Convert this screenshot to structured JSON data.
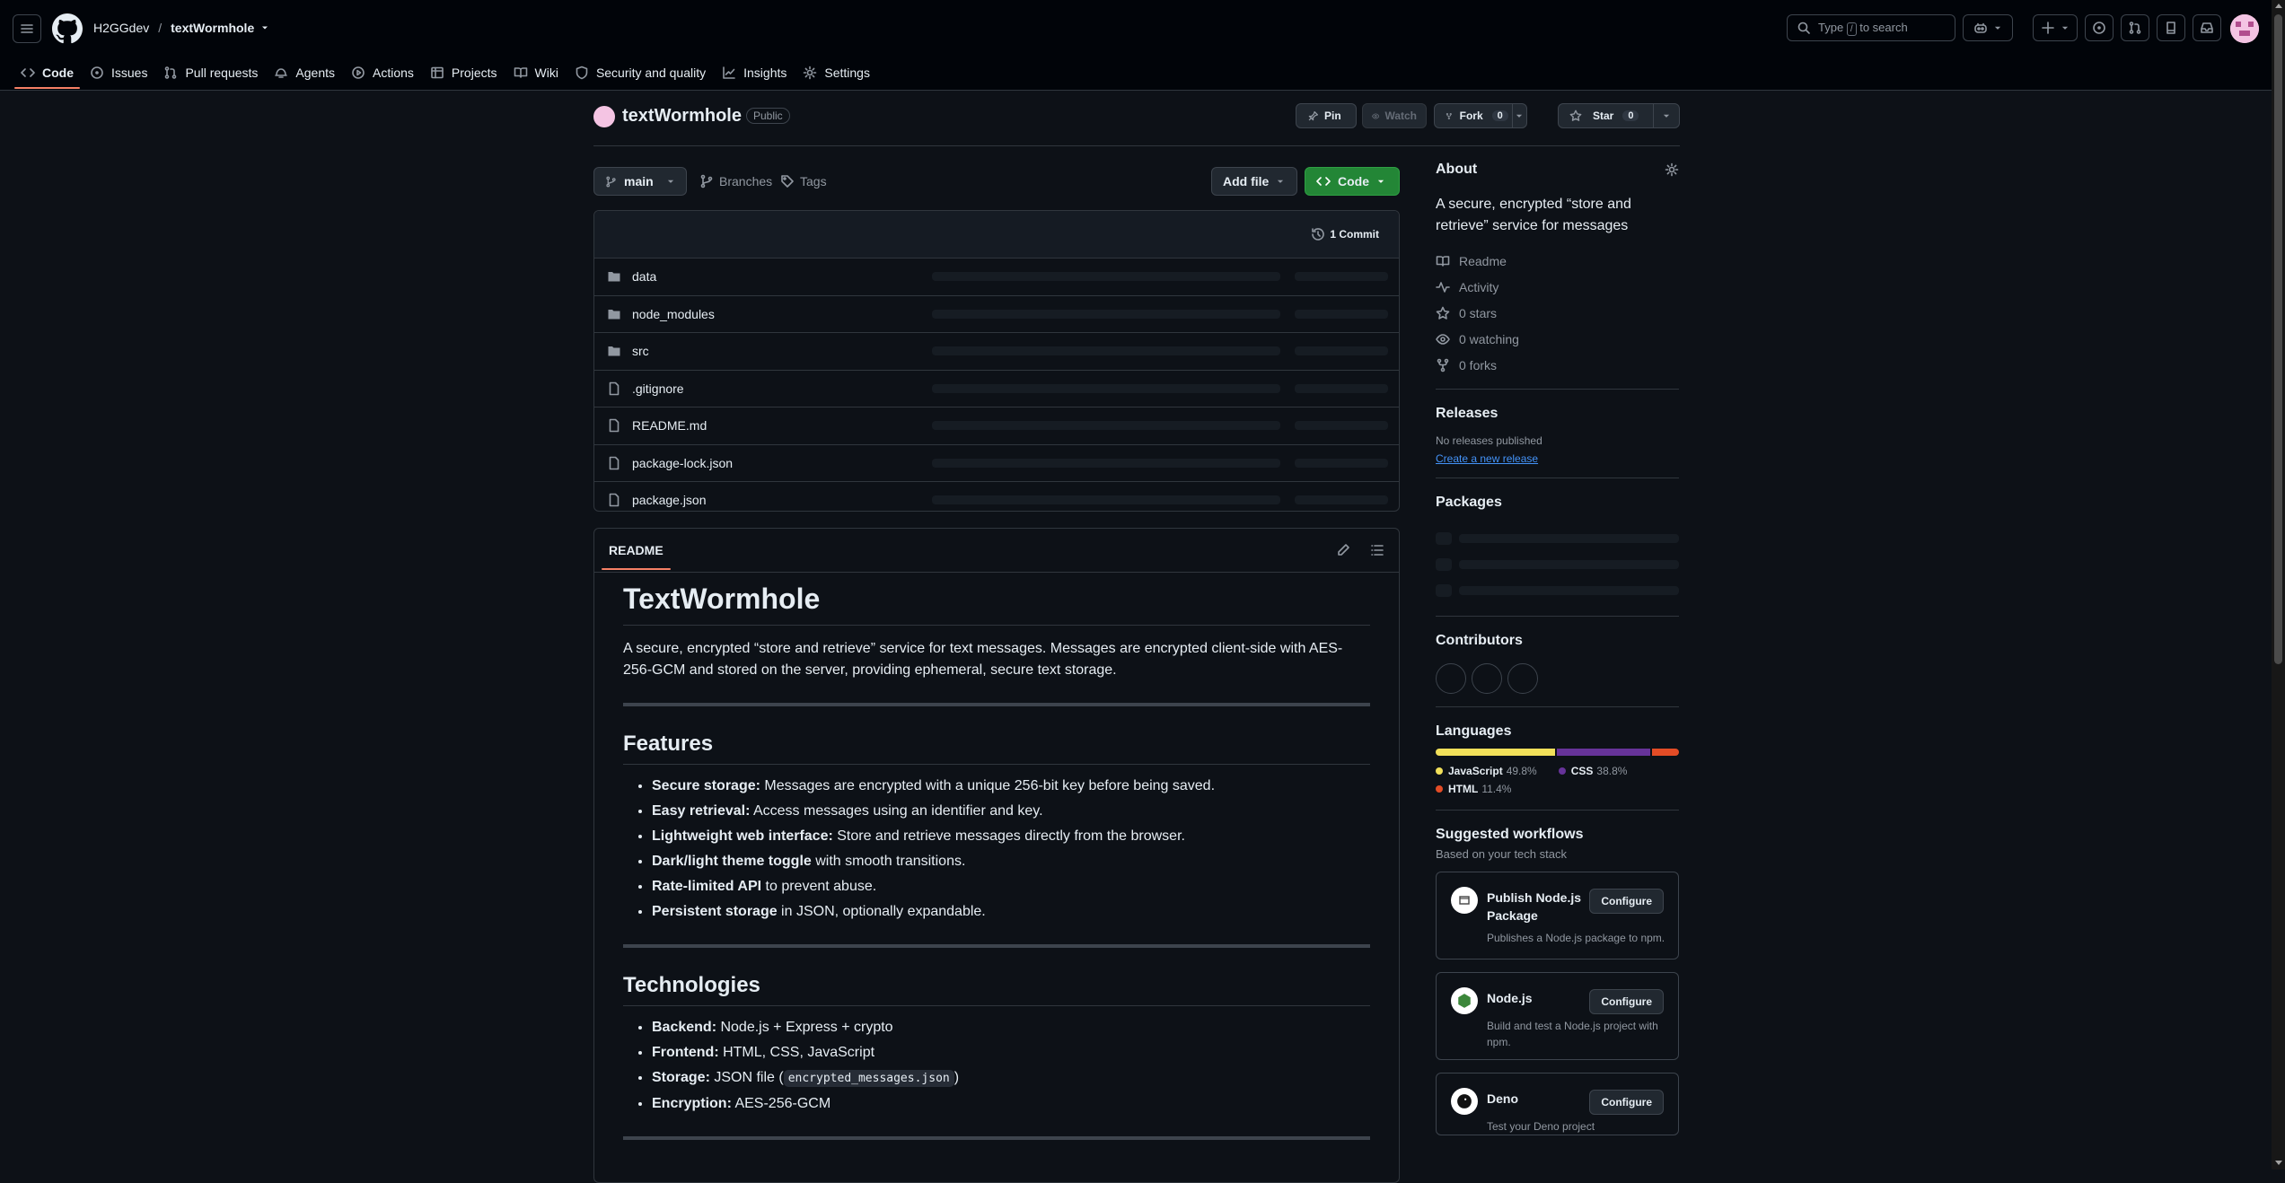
{
  "header": {
    "owner": "H2GGdev",
    "separator": "/",
    "repo": "textWormhole",
    "search_prefix": "Type",
    "search_key": "/",
    "search_suffix": "to search"
  },
  "tabs": [
    {
      "label": "Code",
      "icon": "code-icon"
    },
    {
      "label": "Issues",
      "icon": "issue-icon"
    },
    {
      "label": "Pull requests",
      "icon": "pull-request-icon"
    },
    {
      "label": "Agents",
      "icon": "agents-icon"
    },
    {
      "label": "Actions",
      "icon": "play-icon"
    },
    {
      "label": "Projects",
      "icon": "table-icon"
    },
    {
      "label": "Wiki",
      "icon": "book-icon"
    },
    {
      "label": "Security and quality",
      "icon": "shield-icon"
    },
    {
      "label": "Insights",
      "icon": "graph-icon"
    },
    {
      "label": "Settings",
      "icon": "gear-icon"
    }
  ],
  "repo_head": {
    "name": "textWormhole",
    "visibility": "Public",
    "pin": "Pin",
    "watch": "Watch",
    "fork": "Fork",
    "fork_count": "0",
    "star": "Star",
    "star_count": "0"
  },
  "file_nav": {
    "branch": "main",
    "branches": "Branches",
    "tags": "Tags",
    "add_file": "Add file",
    "code": "Code",
    "commits": "1 Commit"
  },
  "files": [
    {
      "name": "data",
      "type": "folder"
    },
    {
      "name": "node_modules",
      "type": "folder"
    },
    {
      "name": "src",
      "type": "folder"
    },
    {
      "name": ".gitignore",
      "type": "file"
    },
    {
      "name": "README.md",
      "type": "file"
    },
    {
      "name": "package-lock.json",
      "type": "file"
    },
    {
      "name": "package.json",
      "type": "file"
    }
  ],
  "readme": {
    "tab": "README",
    "title": "TextWormhole",
    "intro": "A secure, encrypted “store and retrieve” service for text messages. Messages are encrypted client-side with AES-256-GCM and stored on the server, providing ephemeral, secure text storage.",
    "features_heading": "Features",
    "features": [
      {
        "bold": "Secure storage:",
        "text": " Messages are encrypted with a unique 256-bit key before being saved."
      },
      {
        "bold": "Easy retrieval:",
        "text": " Access messages using an identifier and key."
      },
      {
        "bold": "Lightweight web interface:",
        "text": " Store and retrieve messages directly from the browser."
      },
      {
        "bold": "Dark/light theme toggle",
        "text": " with smooth transitions."
      },
      {
        "bold": "Rate-limited API",
        "text": " to prevent abuse."
      },
      {
        "bold": "Persistent storage",
        "text": " in JSON, optionally expandable."
      }
    ],
    "tech_heading": "Technologies",
    "tech": [
      {
        "bold": "Backend:",
        "text": " Node.js + Express + crypto"
      },
      {
        "bold": "Frontend:",
        "text": " HTML, CSS, JavaScript"
      },
      {
        "bold": "Storage:",
        "text": " JSON file (",
        "code": "encrypted_messages.json",
        "after": ")"
      },
      {
        "bold": "Encryption:",
        "text": " AES-256-GCM"
      }
    ]
  },
  "about": {
    "heading": "About",
    "description": "A secure, encrypted “store and retrieve” service for messages",
    "readme": "Readme",
    "activity": "Activity",
    "stars": "0 stars",
    "watching": "0 watching",
    "forks": "0 forks"
  },
  "releases": {
    "heading": "Releases",
    "none": "No releases published",
    "create": "Create a new release"
  },
  "packages": {
    "heading": "Packages"
  },
  "contributors": {
    "heading": "Contributors"
  },
  "languages": {
    "heading": "Languages",
    "items": [
      {
        "name": "JavaScript",
        "percent": "49.8%",
        "value": 49.8,
        "color": "#f1e05a"
      },
      {
        "name": "CSS",
        "percent": "38.8%",
        "value": 38.8,
        "color": "#663399"
      },
      {
        "name": "HTML",
        "percent": "11.4%",
        "value": 11.4,
        "color": "#e34c26"
      }
    ]
  },
  "workflows": {
    "heading": "Suggested workflows",
    "subheading": "Based on your tech stack",
    "items": [
      {
        "name": "Publish Node.js Package",
        "desc": "Publishes a Node.js package to npm.",
        "button": "Configure"
      },
      {
        "name": "Node.js",
        "desc": "Build and test a Node.js project with npm.",
        "button": "Configure"
      },
      {
        "name": "Deno",
        "desc": "Test your Deno project",
        "button": "Configure"
      }
    ]
  }
}
